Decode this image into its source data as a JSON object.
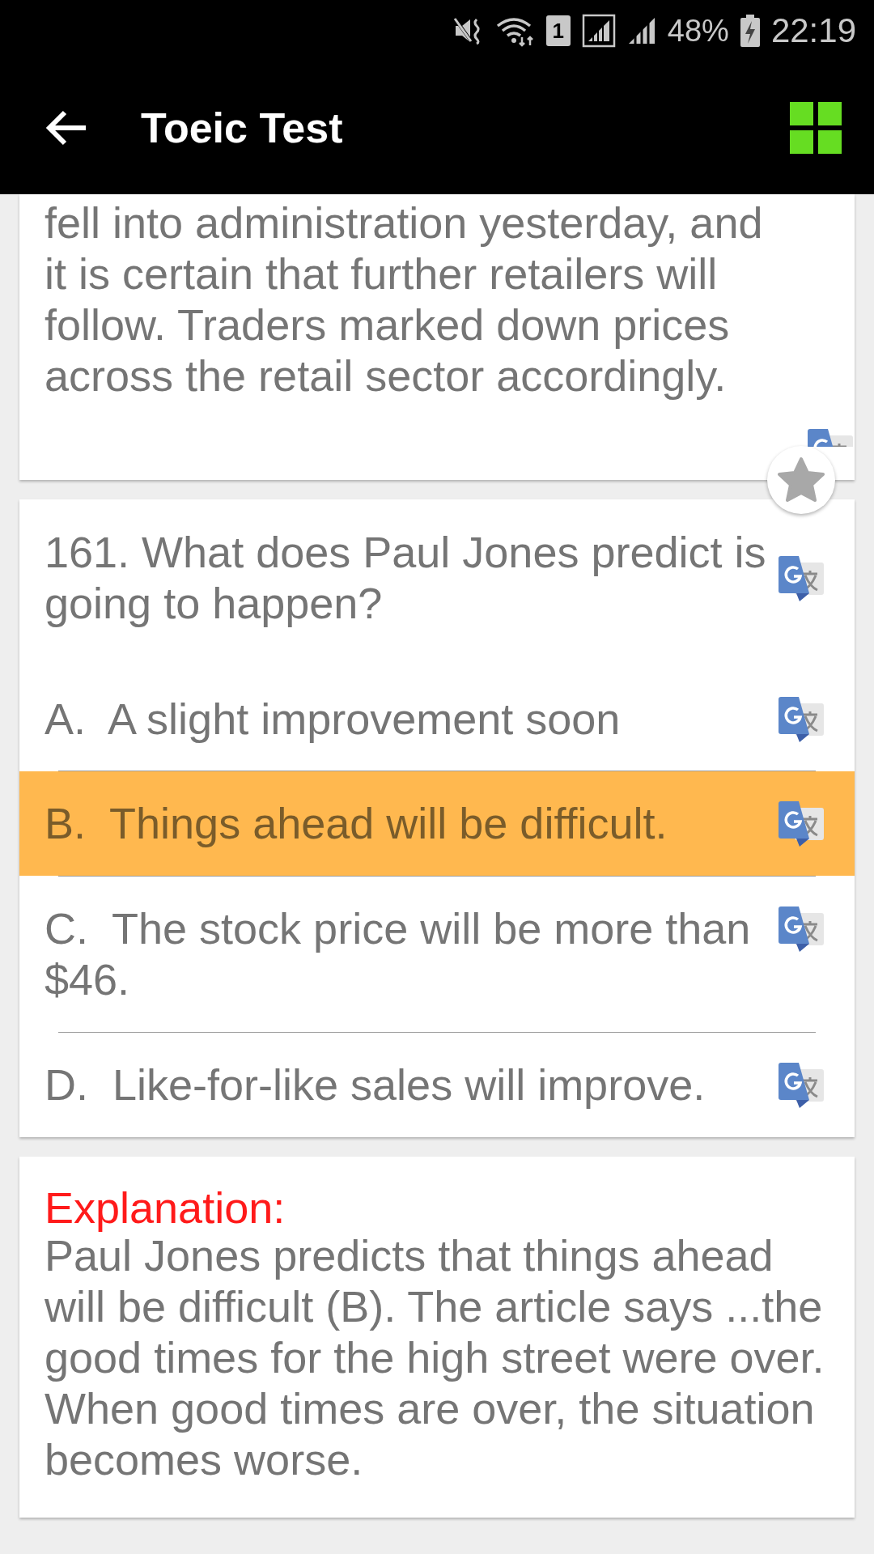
{
  "status_bar": {
    "sim_slot": "1",
    "battery": "48%",
    "time": "22:19"
  },
  "toolbar": {
    "title": "Toeic Test"
  },
  "passage": {
    "text": "fell into administration yesterday, and it is certain that further retailers will follow. Traders marked down prices across the retail sector accordingly."
  },
  "question": {
    "text": "161. What does Paul Jones predict is going to happen?"
  },
  "options": [
    {
      "letter": "A.",
      "text": "A slight improvement soon",
      "selected": false
    },
    {
      "letter": "B.",
      "text": "Things ahead will be difficult.",
      "selected": true
    },
    {
      "letter": "C.",
      "text": "The stock price will be more than $46.",
      "selected": false
    },
    {
      "letter": "D.",
      "text": "Like-for-like sales will improve.",
      "selected": false
    }
  ],
  "explanation": {
    "heading": "Explanation:",
    "text": "Paul Jones predicts that things ahead will be difficult (B). The article says ...the good times for the high street were over. When good times are over, the situation becomes worse."
  }
}
